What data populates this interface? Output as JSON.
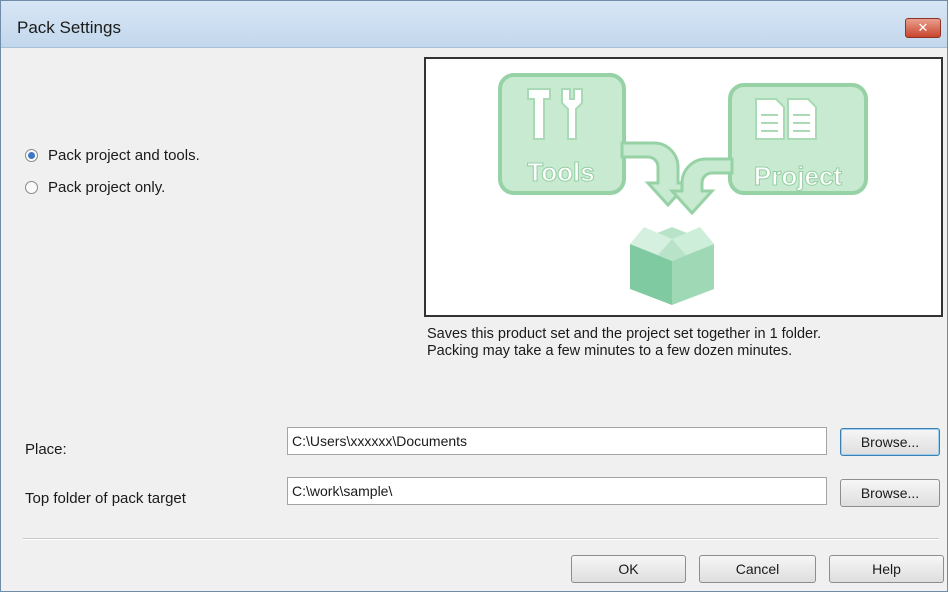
{
  "window": {
    "title": "Pack Settings",
    "close_glyph": "✕"
  },
  "options": {
    "pack_project_and_tools": {
      "label": "Pack project and tools.",
      "checked": true
    },
    "pack_project_only": {
      "label": "Pack project only.",
      "checked": false
    }
  },
  "illustration": {
    "tools_label": "Tools",
    "project_label": "Project",
    "icons": [
      "wrench-icon",
      "document-icon",
      "box-icon",
      "arrow-icon"
    ],
    "colors": {
      "light_green": "#c5e8cc",
      "green": "#8ccd9b",
      "box_green": "#76c59a"
    }
  },
  "description": {
    "line1": "Saves this product set and the project set together in 1 folder.",
    "line2": "Packing may take a few minutes to a few dozen minutes."
  },
  "place": {
    "label": "Place:",
    "value": "C:\\Users\\xxxxxx\\Documents",
    "browse_label": "Browse..."
  },
  "top_folder": {
    "label": "Top folder of pack target",
    "value": "C:\\work\\sample\\",
    "browse_label": "Browse..."
  },
  "footer": {
    "ok_label": "OK",
    "cancel_label": "Cancel",
    "help_label": "Help"
  }
}
